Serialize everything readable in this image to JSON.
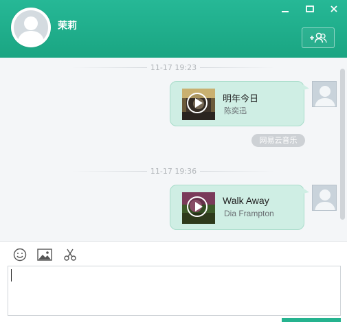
{
  "header": {
    "contact_name": "茉莉",
    "window_buttons": [
      "minimize",
      "maximize",
      "close"
    ],
    "add_friend_icon": "add-user-icon",
    "accent_color": "#1fae8b"
  },
  "chat": {
    "messages": [
      {
        "timestamp": "11-17 19:23",
        "song_title": "明年今日",
        "artist": "陈奕迅",
        "source": "网易云音乐"
      },
      {
        "timestamp": "11-17 19:36",
        "song_title": "Walk Away",
        "artist": "Dia Frampton"
      }
    ]
  },
  "toolbar": {
    "icons": [
      "emoji-icon",
      "image-icon",
      "scissors-icon"
    ]
  },
  "input": {
    "value": ""
  }
}
